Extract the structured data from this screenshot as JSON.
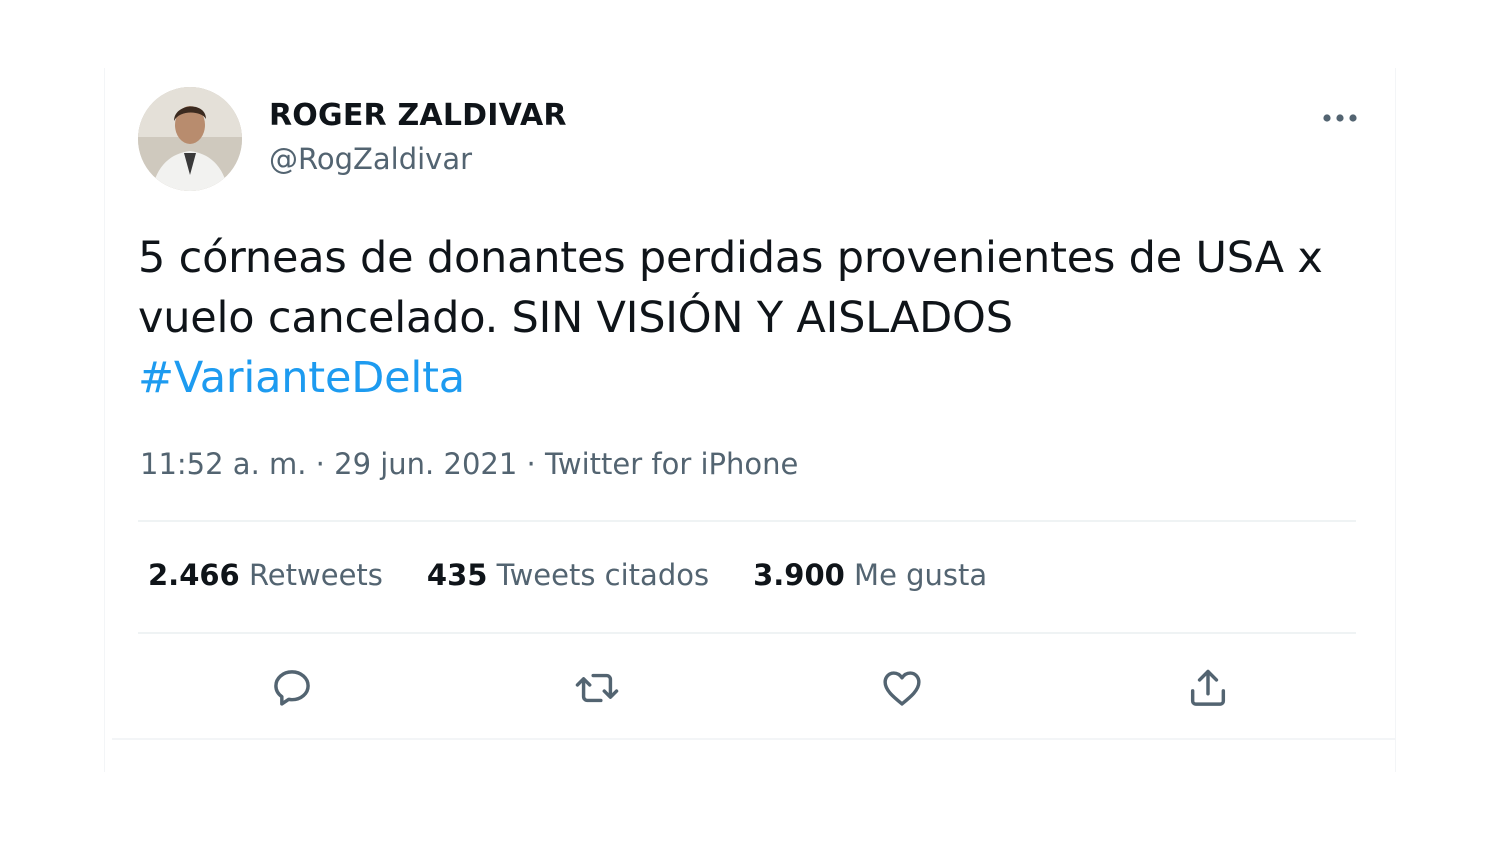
{
  "author": {
    "name": "ROGER ZALDIVAR",
    "handle": "@RogZaldivar"
  },
  "tweet": {
    "text": "5 córneas de donantes perdidas provenientes de USA x\nvuelo cancelado. SIN VISIÓN Y AISLADOS",
    "hashtag": "#VarianteDelta"
  },
  "meta": {
    "time": "11:52 a. m.",
    "sep1": " · ",
    "date": "29 jun. 2021",
    "sep2": " · ",
    "source": "Twitter for iPhone"
  },
  "stats": {
    "retweets": {
      "value": "2.466",
      "label": "Retweets"
    },
    "quotes": {
      "value": "435",
      "label": "Tweets citados"
    },
    "likes": {
      "value": "3.900",
      "label": "Me gusta"
    }
  },
  "actions": [
    "reply-icon",
    "retweet-icon",
    "like-icon",
    "share-icon"
  ],
  "colors": {
    "text": "#0f1419",
    "secondary": "#536471",
    "link": "#1d9bf0",
    "divider": "#eff3f4"
  }
}
